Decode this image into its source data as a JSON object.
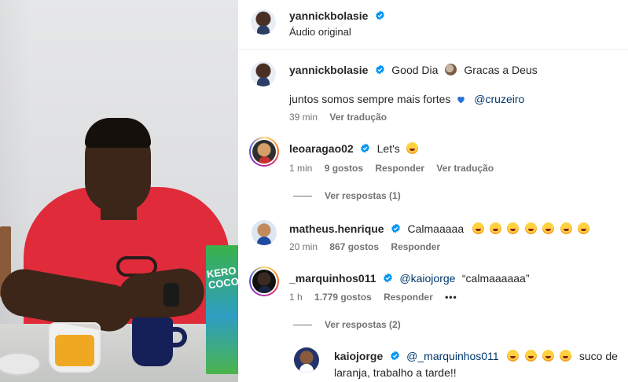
{
  "header": {
    "username": "yannickbolasie",
    "subtitle": "Áudio original"
  },
  "caption": {
    "username": "yannickbolasie",
    "line1_a": "Good Dia",
    "line1_b": "Gracas a Deus",
    "line2_a": "juntos somos sempre mais fortes",
    "line2_mention": "@cruzeiro",
    "time": "39 min",
    "translate": "Ver tradução"
  },
  "comments": [
    {
      "username": "leoaragao02",
      "text": "Let's",
      "time": "1 min",
      "likes": "9 gostos",
      "reply": "Responder",
      "translate": "Ver tradução",
      "view_replies": "Ver respostas (1)"
    },
    {
      "username": "matheus.henrique",
      "text": "Calmaaaaa",
      "time": "20 min",
      "likes": "867 gostos",
      "reply": "Responder"
    },
    {
      "username": "_marquinhos011",
      "mention": "@kaiojorge",
      "text": "“calmaaaaaa”",
      "time": "1 h",
      "likes": "1.779 gostos",
      "reply": "Responder",
      "more": "•••",
      "view_replies": "Ver respostas (2)"
    }
  ],
  "reply": {
    "username": "kaiojorge",
    "mention": "@_marquinhos011",
    "text_a": "suco de",
    "text_b": "laranja, trabalho a tarde!!"
  },
  "photo": {
    "carton_text": "KERO COCO"
  },
  "colors": {
    "verified": "#0095f6",
    "mention": "#00376b",
    "meta": "#737373",
    "shirt": "#e02b3a"
  }
}
